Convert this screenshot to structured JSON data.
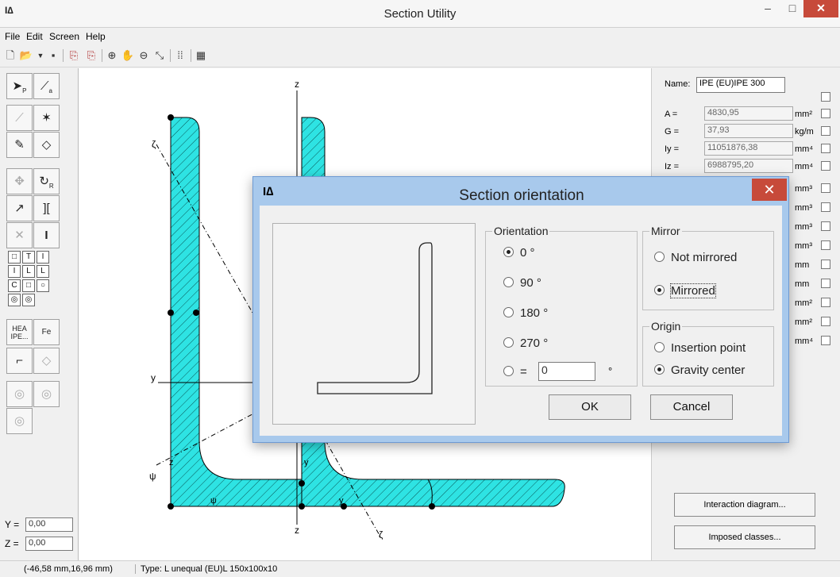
{
  "window": {
    "title": "Section Utility",
    "icon_label": "I∆"
  },
  "menu": [
    "File",
    "Edit",
    "Screen",
    "Help"
  ],
  "toolbar_icons": [
    "new-icon",
    "open-icon",
    "dropdown-icon",
    "save-icon",
    "export-icon",
    "export-red-icon",
    "zoom-in-icon",
    "pan-hand-icon",
    "zoom-out-icon",
    "zoom-extents-icon",
    "grid-icon",
    "calculator-icon"
  ],
  "left_tools": {
    "letters": {
      "select": "P",
      "line": "a",
      "coord": "R",
      "hea": "HEA\nIPE...",
      "fe": "Fe"
    },
    "small_shapes": [
      "I",
      "T",
      "I",
      "I",
      "L",
      "L",
      "C",
      "□",
      "○",
      "◎",
      "◎"
    ]
  },
  "coords": {
    "y_label": "Y =",
    "y_value": "0,00",
    "z_label": "Z =",
    "z_value": "0,00"
  },
  "canvas": {
    "axis_z_top": "z",
    "axis_z_bottom": "z",
    "axis_y": "y",
    "axis_zeta_top": "ζ",
    "axis_zeta_bottom": "ζ",
    "axis_psi_left": "ψ",
    "axis_psi_bottom": "ψ",
    "axis_z_small": "z",
    "axis_y_small": "y",
    "axis_y_small2": "y"
  },
  "properties": {
    "name_label": "Name:",
    "name_value": "IPE (EU)IPE 300",
    "rows": [
      {
        "label": "A =",
        "value": "4830,95",
        "unit": "mm²"
      },
      {
        "label": "G =",
        "value": "37,93",
        "unit": "kg/m"
      },
      {
        "label": "Iy =",
        "value": "11051876,38",
        "unit": "mm⁴"
      },
      {
        "label": "Iz =",
        "value": "6988795,20",
        "unit": "mm⁴"
      }
    ],
    "units_hidden": [
      "mm³",
      "mm³",
      "mm³",
      "mm³",
      "mm",
      "mm",
      "mm²",
      "mm²",
      "mm⁴"
    ],
    "btn_interaction": "Interaction diagram...",
    "btn_imposed": "Imposed classes..."
  },
  "status": {
    "coords": "(-46,58 mm,16,96 mm)",
    "type": "Type: L unequal (EU)L 150x100x10"
  },
  "dialog": {
    "title": "Section orientation",
    "orientation_label": "Orientation",
    "orientation_options": [
      "0 °",
      "90 °",
      "180 °",
      "270 °",
      "="
    ],
    "orientation_selected": 0,
    "custom_value": "0",
    "custom_unit": "°",
    "mirror_label": "Mirror",
    "mirror_options": [
      "Not mirrored",
      "Mirrored"
    ],
    "mirror_selected": 1,
    "origin_label": "Origin",
    "origin_options": [
      "Insertion point",
      "Gravity center"
    ],
    "origin_selected": 1,
    "ok": "OK",
    "cancel": "Cancel"
  },
  "colors": {
    "section_fill": "#2ee3e3",
    "titlebar_close": "#c74a3a"
  }
}
